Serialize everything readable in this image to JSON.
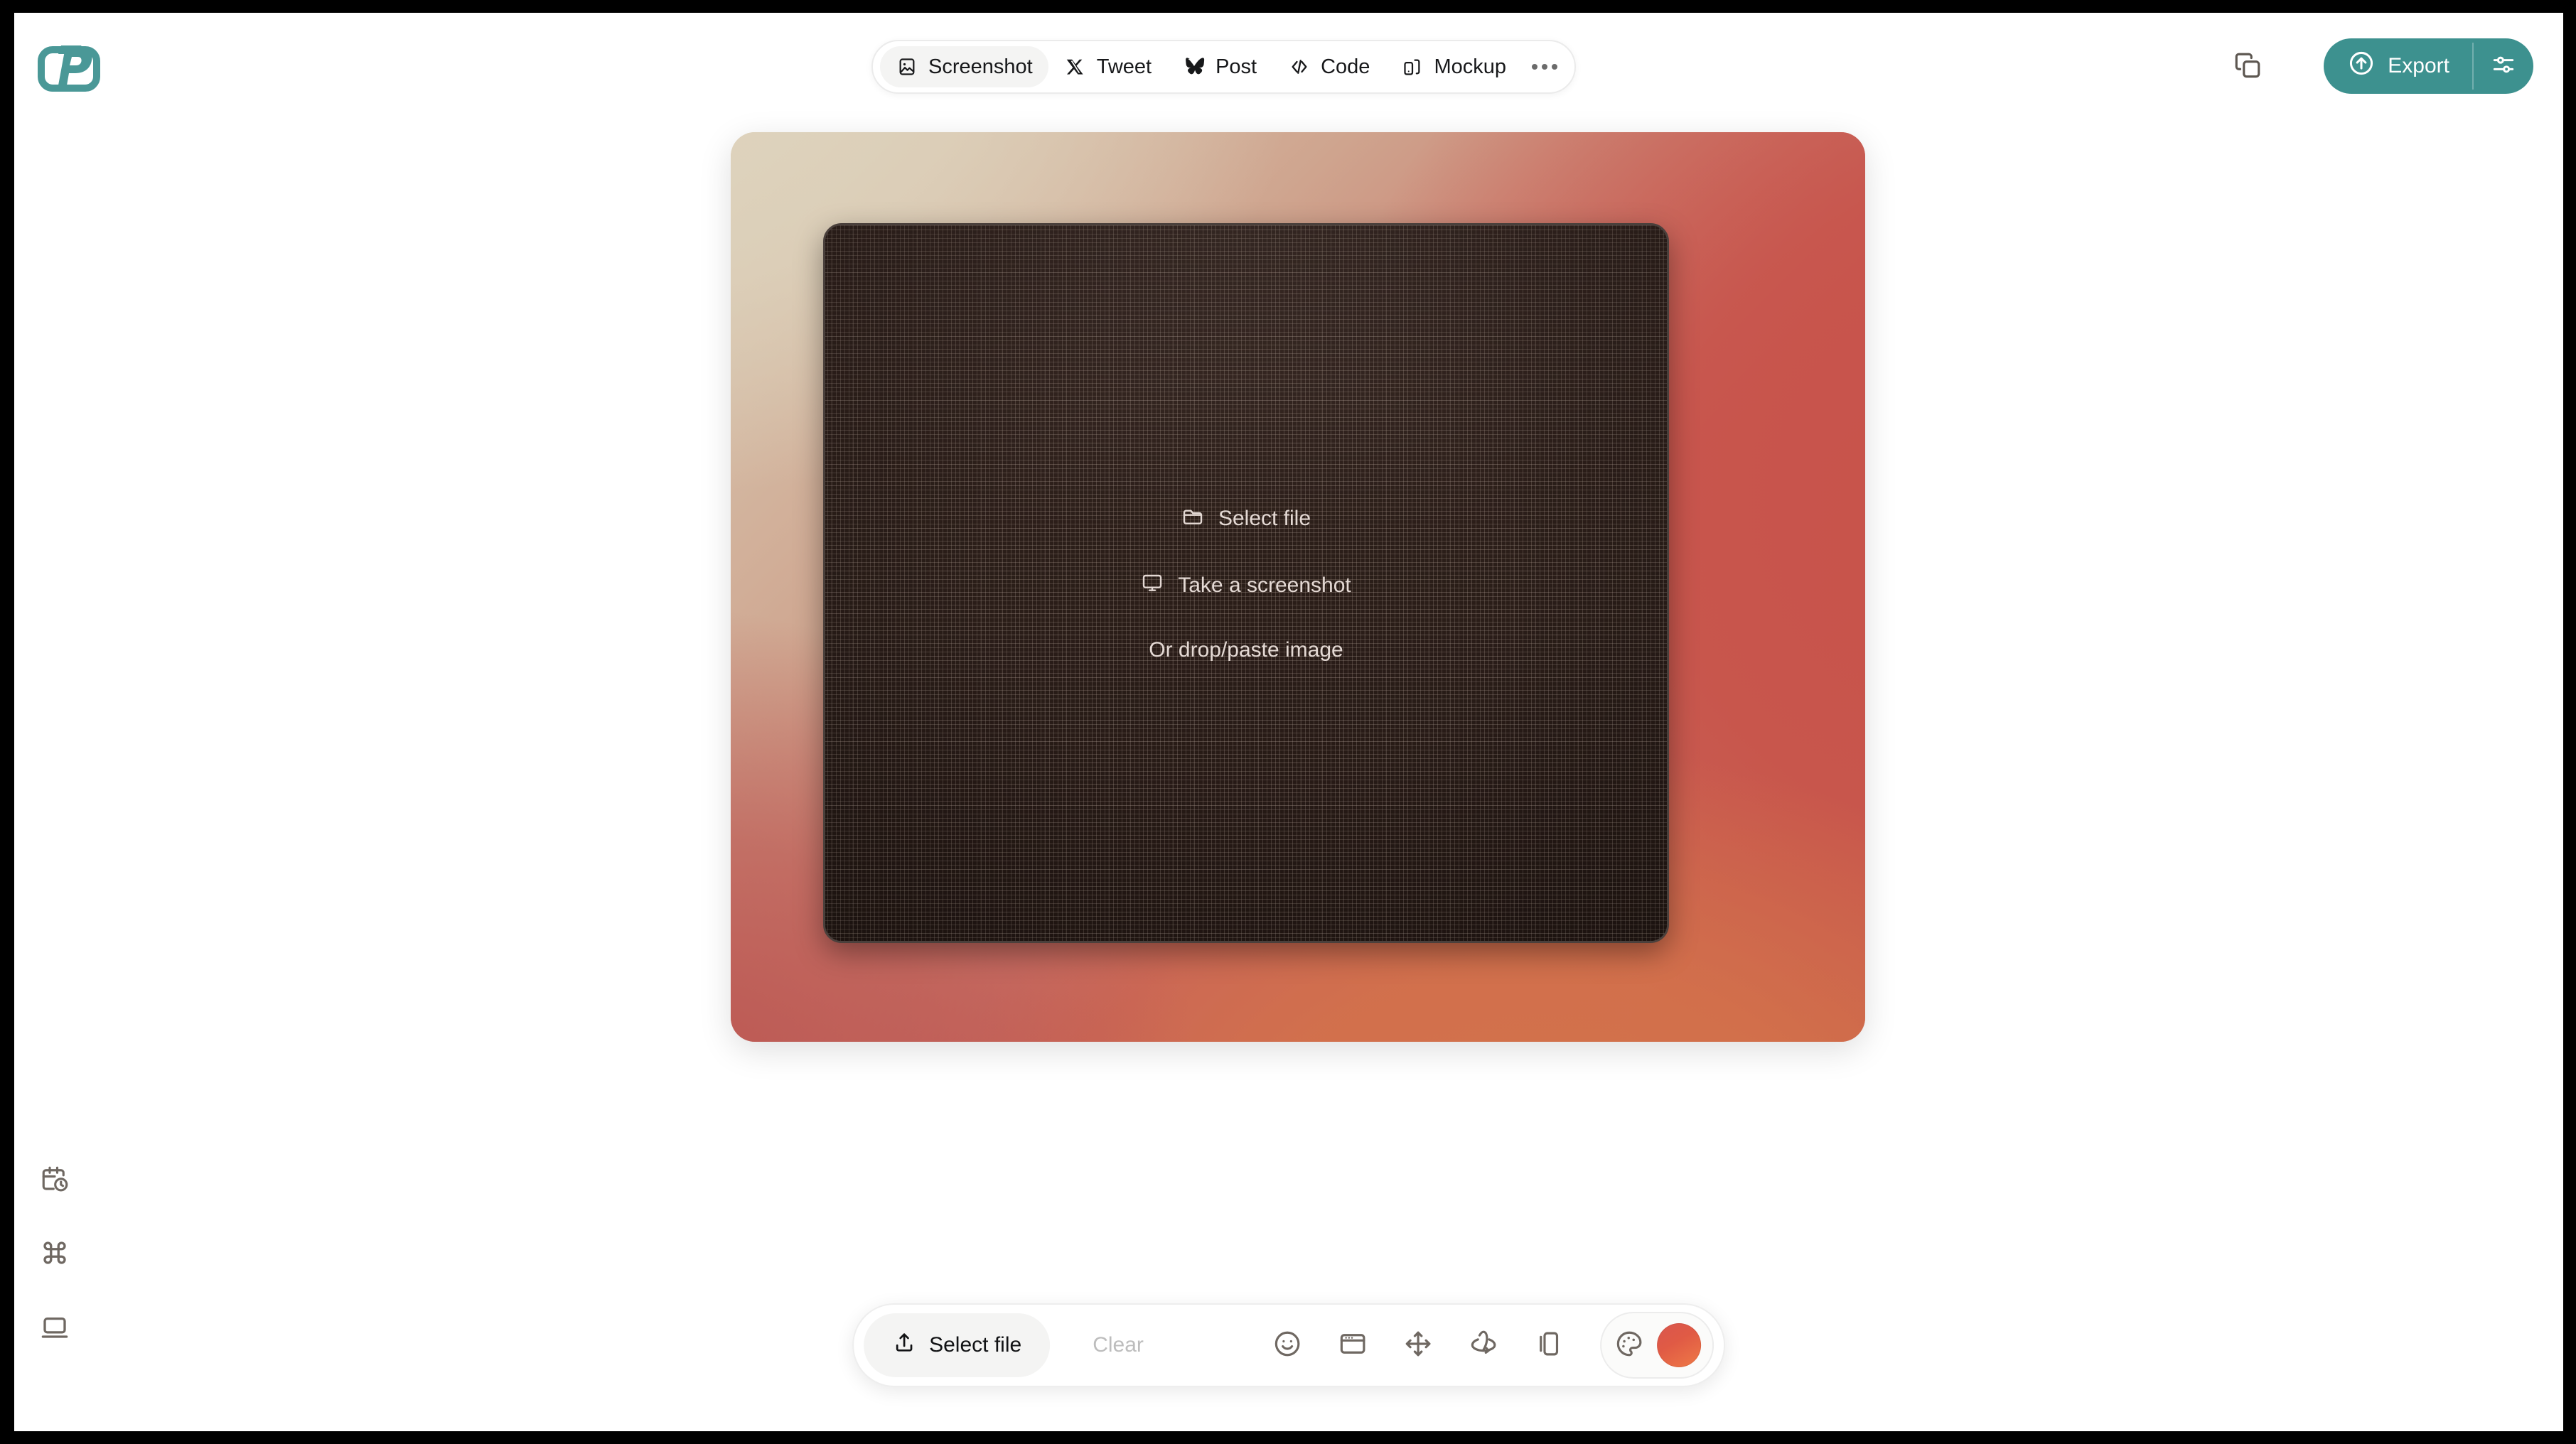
{
  "app": {
    "logo_name": "pika-logo",
    "brand_color": "#3d918f"
  },
  "topbar": {
    "tabs": [
      {
        "label": "Screenshot",
        "icon": "image-icon",
        "active": true
      },
      {
        "label": "Tweet",
        "icon": "x-twitter-icon",
        "active": false
      },
      {
        "label": "Post",
        "icon": "bluesky-butterfly-icon",
        "active": false
      },
      {
        "label": "Code",
        "icon": "code-brackets-icon",
        "active": false
      },
      {
        "label": "Mockup",
        "icon": "device-mockup-icon",
        "active": false
      }
    ],
    "more_label": "More options",
    "copy_label": "Copy to clipboard",
    "export_label": "Export",
    "export_settings_label": "Export settings"
  },
  "rail": {
    "items": [
      {
        "name": "history-icon",
        "label": "History"
      },
      {
        "name": "command-key-icon",
        "label": "Shortcuts"
      },
      {
        "name": "laptop-icon",
        "label": "Device"
      }
    ]
  },
  "canvas": {
    "gradient": {
      "top_left": "#ded3bd",
      "right": "#c8524a",
      "bottom": "#d4734a",
      "bottom_left": "#bb5450"
    },
    "dropzone": {
      "background": "#2a1d19",
      "select_file": "Select file",
      "select_file_icon": "folder-icon",
      "take_screenshot": "Take a screenshot",
      "take_screenshot_icon": "monitor-icon",
      "drop_hint": "Or drop/paste image"
    }
  },
  "bottombar": {
    "select_file": "Select file",
    "select_file_icon": "upload-icon",
    "clear": "Clear",
    "tools": [
      {
        "name": "emoji-icon",
        "label": "Emoji"
      },
      {
        "name": "browser-frame-icon",
        "label": "Browser frame"
      },
      {
        "name": "position-icon",
        "label": "Position"
      },
      {
        "name": "rotate-3d-icon",
        "label": "3D rotate"
      },
      {
        "name": "duplicate-icon",
        "label": "Duplicate"
      }
    ],
    "palette_icon": "palette-icon",
    "color_swatch": "#e05a45",
    "color_swatch_label": "Background color"
  }
}
